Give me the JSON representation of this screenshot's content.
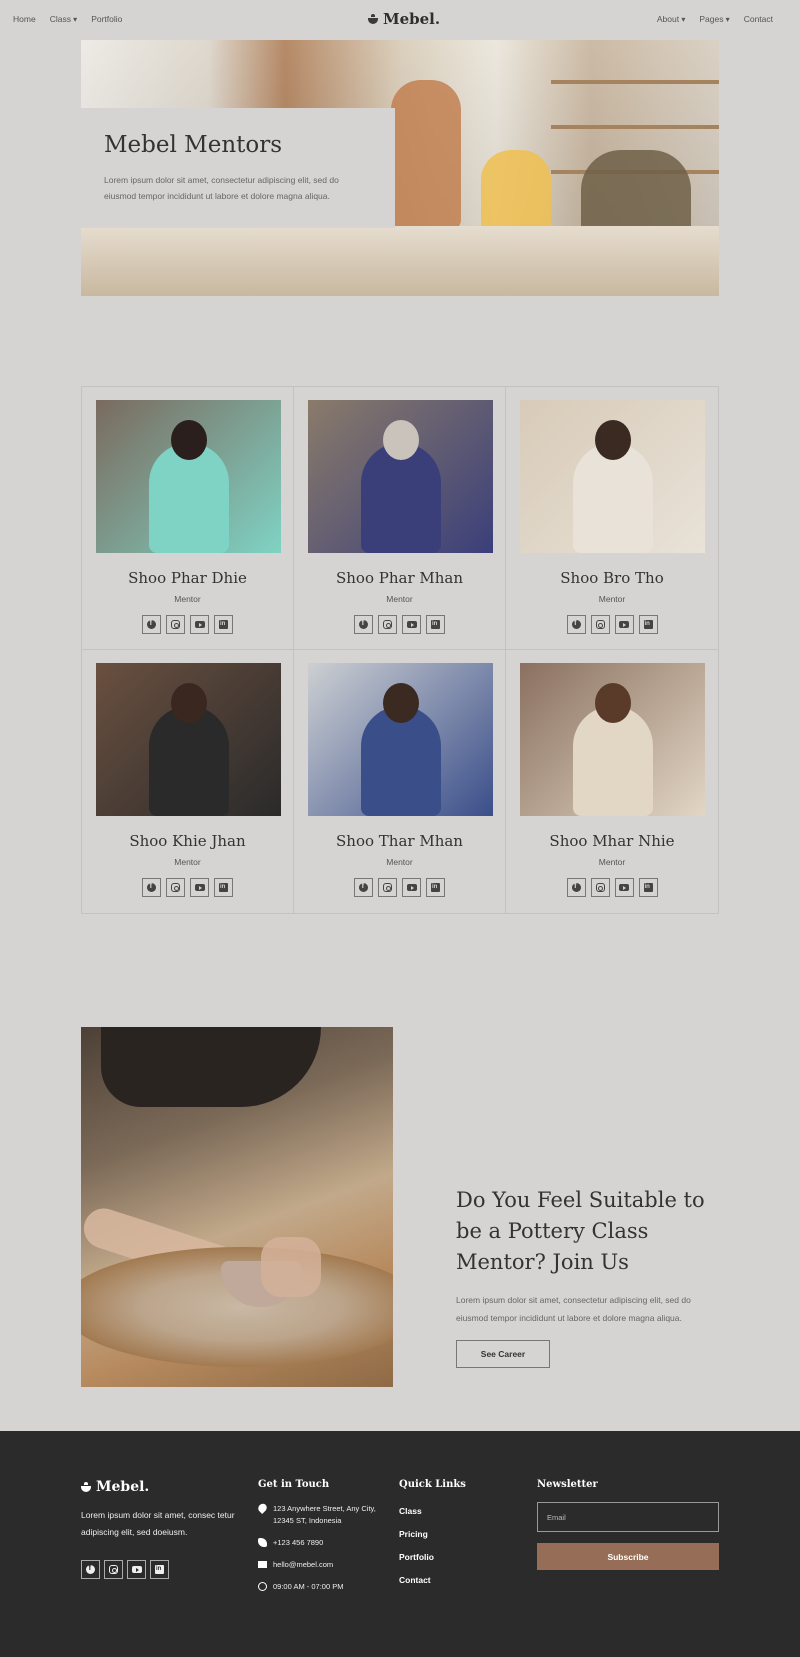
{
  "nav": {
    "left": [
      "Home",
      "Class",
      "Portfolio"
    ],
    "brand": "Mebel.",
    "right": [
      "About",
      "Pages",
      "Contact"
    ]
  },
  "hero": {
    "title": "Mebel Mentors",
    "text": "Lorem ipsum dolor sit amet, consectetur adipiscing elit, sed do eiusmod tempor incididunt ut labore et dolore magna aliqua."
  },
  "team": [
    {
      "name": "Shoo Phar Dhie",
      "role": "Mentor",
      "colors": [
        "#7a6a5e",
        "#2a1f1c",
        "#7fd3c4"
      ]
    },
    {
      "name": "Shoo Phar Mhan",
      "role": "Mentor",
      "colors": [
        "#8a7b6a",
        "#c9c3bc",
        "#3a3f7a"
      ]
    },
    {
      "name": "Shoo Bro Tho",
      "role": "Mentor",
      "colors": [
        "#d8cbb8",
        "#3a2a22",
        "#e8e2d8"
      ]
    },
    {
      "name": "Shoo Khie Jhan",
      "role": "Mentor",
      "colors": [
        "#6a5040",
        "#3a2820",
        "#2a2a2a"
      ]
    },
    {
      "name": "Shoo Thar Mhan",
      "role": "Mentor",
      "colors": [
        "#cdd0d2",
        "#3a2a22",
        "#3a4e8a"
      ]
    },
    {
      "name": "Shoo Mhar Nhie",
      "role": "Mentor",
      "colors": [
        "#8a7060",
        "#5a3a28",
        "#e2d6c4"
      ]
    }
  ],
  "join": {
    "title": "Do You Feel Suitable to be a Pottery Class Mentor? Join Us",
    "text": "Lorem ipsum dolor sit amet, consectetur adipiscing elit, sed do eiusmod tempor incididunt ut labore et dolore magna aliqua.",
    "button": "See Career"
  },
  "footer": {
    "brand": "Mebel.",
    "desc": "Lorem ipsum dolor sit amet, consec tetur adipiscing elit, sed doeiusm.",
    "contact_title": "Get in Touch",
    "address": "123 Anywhere Street, Any City, 12345 ST, Indonesia",
    "phone": "+123 456 7890",
    "email": "hello@mebel.com",
    "hours": "09:00 AM - 07:00 PM",
    "links_title": "Quick Links",
    "links": [
      "Class",
      "Pricing",
      "Portfolio",
      "Contact"
    ],
    "newsletter_title": "Newsletter",
    "email_placeholder": "Email",
    "subscribe": "Subscribe"
  },
  "icons": {
    "social": [
      "facebook-icon",
      "instagram-icon",
      "youtube-icon",
      "linkedin-icon"
    ],
    "contact": [
      "map-pin-icon",
      "phone-icon",
      "mail-icon",
      "clock-icon"
    ]
  },
  "colors": {
    "background": "#d6d4d2",
    "footer": "#2b2b2b",
    "accent": "#966d56",
    "text": "#333333"
  }
}
